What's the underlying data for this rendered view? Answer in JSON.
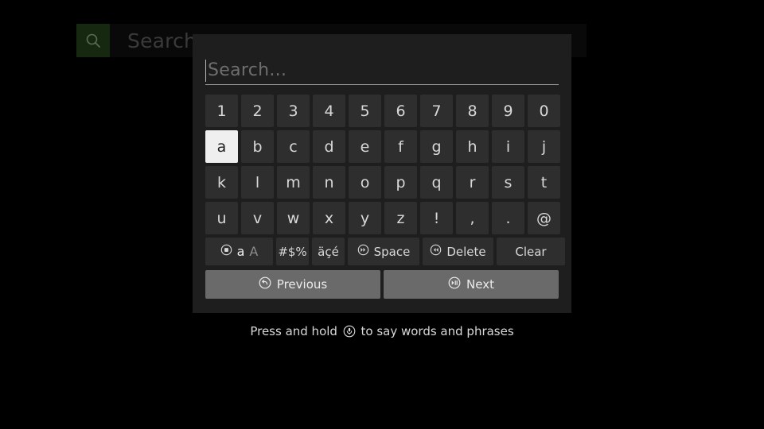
{
  "background": {
    "search_icon": "search-icon",
    "search_text": "Search..."
  },
  "dialog": {
    "input": {
      "placeholder": "Search...",
      "value": ""
    },
    "rows": [
      {
        "id": "row-digits",
        "keys": [
          "1",
          "2",
          "3",
          "4",
          "5",
          "6",
          "7",
          "8",
          "9",
          "0"
        ]
      },
      {
        "id": "row-letters-1",
        "keys": [
          "a",
          "b",
          "c",
          "d",
          "e",
          "f",
          "g",
          "h",
          "i",
          "j"
        ]
      },
      {
        "id": "row-letters-2",
        "keys": [
          "k",
          "l",
          "m",
          "n",
          "o",
          "p",
          "q",
          "r",
          "s",
          "t"
        ]
      },
      {
        "id": "row-letters-3",
        "keys": [
          "u",
          "v",
          "w",
          "x",
          "y",
          "z",
          "!",
          ",",
          ".",
          "@"
        ]
      }
    ],
    "selected_key": "a",
    "function_row": [
      {
        "id": "case",
        "label_a": "a",
        "label_A": "A",
        "icon": "circle-square-button-icon"
      },
      {
        "id": "symbols",
        "label": "#$%",
        "icon": null
      },
      {
        "id": "accents",
        "label": "äçé",
        "icon": null
      },
      {
        "id": "space",
        "label": "Space",
        "icon": "circle-fast-forward-icon"
      },
      {
        "id": "delete",
        "label": "Delete",
        "icon": "circle-rewind-icon"
      },
      {
        "id": "clear",
        "label": "Clear",
        "icon": null
      }
    ],
    "nav": [
      {
        "id": "previous",
        "label": "Previous",
        "icon": "circle-back-arrow-icon"
      },
      {
        "id": "next",
        "label": "Next",
        "icon": "circle-play-pause-icon"
      }
    ]
  },
  "hint": {
    "before": "Press and hold",
    "icon": "circle-microphone-icon",
    "after": "to say words and phrases"
  },
  "colors": {
    "background": "#000000",
    "dialog": "#1e1e1e",
    "key": "#2e2e2e",
    "key_selected": "#efefef",
    "nav_button": "#6a6a6a",
    "search_icon_box": "#16280f",
    "text": "#d8d8d8"
  }
}
